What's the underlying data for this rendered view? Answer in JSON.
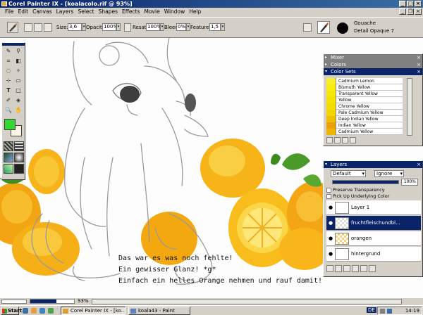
{
  "window": {
    "title": "Corel Painter IX - [koalacolo.rif @ 93%]"
  },
  "menu": [
    "File",
    "Edit",
    "Canvas",
    "Layers",
    "Select",
    "Shapes",
    "Effects",
    "Movie",
    "Window",
    "Help"
  ],
  "property_bar": {
    "size_label": "Size:",
    "size_value": "3,6",
    "opacity_label": "Opacity:",
    "opacity_value": "100%",
    "resat_label": "Resat:",
    "resat_value": "100%",
    "bleed_label": "Bleed:",
    "bleed_value": "0%",
    "feature_label": "Feature:",
    "feature_value": "1,5"
  },
  "brush": {
    "category": "Gouache",
    "variant": "Detail Opaque 7"
  },
  "palettes": {
    "mixer": "Mixer",
    "colors": "Colors",
    "color_sets": "Color Sets",
    "layers": "Layers"
  },
  "color_sets": [
    {
      "name": "Cadmium Lemon",
      "color": "#f7ef2a"
    },
    {
      "name": "Bismuth Yellow",
      "color": "#f8ec10"
    },
    {
      "name": "Transparent Yellow",
      "color": "#f6e60c"
    },
    {
      "name": "Yellow",
      "color": "#f5e200"
    },
    {
      "name": "Chrome Yellow",
      "color": "#f5dc00"
    },
    {
      "name": "Pale Cadmium Yellow",
      "color": "#f3d600"
    },
    {
      "name": "Deep Indian Yellow",
      "color": "#f0c000"
    },
    {
      "name": "Indian Yellow",
      "color": "#eca010"
    },
    {
      "name": "Cadmium Yellow",
      "color": "#eeb600"
    }
  ],
  "layers": {
    "composite": "Default",
    "depth": "Ignore",
    "opacity": "100%",
    "preserve_transparency": "Preserve Transparency",
    "pick_up_underlying": "Pick Up Underlying Color",
    "items": [
      {
        "name": "Layer 1",
        "selected": false
      },
      {
        "name": "fruchtfleischundbl...",
        "selected": true
      },
      {
        "name": "orangen",
        "selected": false
      },
      {
        "name": "hintergrund",
        "selected": false
      }
    ]
  },
  "caption": [
    "Das war es was noch fehlte!",
    "Ein gewisser Glanz! *g*",
    "Einfach ein helles Orange nehmen und rauf damit!"
  ],
  "status": {
    "zoom": "93%"
  },
  "taskbar": {
    "start": "Start",
    "tasks": [
      {
        "label": "Corel Painter IX - [ko...",
        "active": true
      },
      {
        "label": "koala43 - Paint",
        "active": false
      }
    ],
    "language": "DE",
    "clock": "14:19"
  },
  "colors": {
    "main": "#33d633",
    "additional": "#fbf7e4"
  }
}
